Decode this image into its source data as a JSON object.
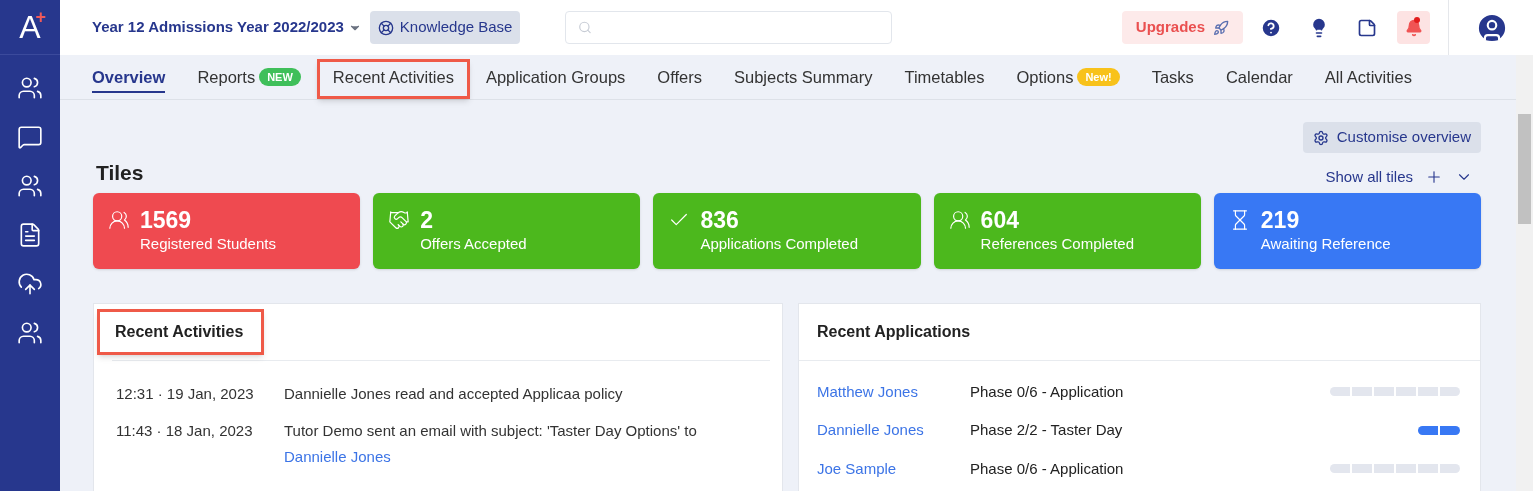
{
  "logo": {
    "letter": "A",
    "mark": "+"
  },
  "header": {
    "year_selector": "Year 12 Admissions Year 2022/2023",
    "knowledge_base": "Knowledge Base",
    "upgrades": "Upgrades",
    "notifications_unread": true
  },
  "tabs": [
    {
      "label": "Overview",
      "selected": true,
      "highlighted": false
    },
    {
      "label": "Reports",
      "selected": false,
      "highlighted": false,
      "badge": {
        "label": "NEW",
        "color": "#3fbf5a"
      }
    },
    {
      "label": "Recent Activities",
      "selected": false,
      "highlighted": true
    },
    {
      "label": "Application Groups",
      "selected": false,
      "highlighted": false
    },
    {
      "label": "Offers",
      "selected": false,
      "highlighted": false
    },
    {
      "label": "Subjects Summary",
      "selected": false,
      "highlighted": false
    },
    {
      "label": "Timetables",
      "selected": false,
      "highlighted": false
    },
    {
      "label": "Options",
      "selected": false,
      "highlighted": false,
      "badge": {
        "label": "New!",
        "color": "#f8c21b"
      }
    },
    {
      "label": "Tasks",
      "selected": false,
      "highlighted": false
    },
    {
      "label": "Calendar",
      "selected": false,
      "highlighted": false
    },
    {
      "label": "All Activities",
      "selected": false,
      "highlighted": false
    }
  ],
  "customise_button": "Customise overview",
  "tiles_title": "Tiles",
  "show_all_tiles": "Show all tiles",
  "tiles": [
    {
      "kind": "users",
      "value": "1569",
      "label": "Registered Students",
      "color": "#ef4a50"
    },
    {
      "kind": "handshake",
      "value": "2",
      "label": "Offers Accepted",
      "color": "#4cb81d"
    },
    {
      "kind": "check",
      "value": "836",
      "label": "Applications Completed",
      "color": "#4cb81d"
    },
    {
      "kind": "users",
      "value": "604",
      "label": "References Completed",
      "color": "#4cb81d"
    },
    {
      "kind": "hourglass",
      "value": "219",
      "label": "Awaiting Reference",
      "color": "#3878f4"
    }
  ],
  "recent_activities": {
    "title": "Recent Activities",
    "highlighted": true,
    "items": [
      {
        "time": "12:31 · 19 Jan, 2023",
        "text": "Dannielle Jones read and accepted Applicaa policy"
      },
      {
        "time": "11:43 · 18 Jan, 2023",
        "text": "Tutor Demo sent an email with subject: 'Taster Day Options' to",
        "link": "Dannielle Jones"
      }
    ]
  },
  "recent_applications": {
    "title": "Recent Applications",
    "rows": [
      {
        "name": "Matthew Jones",
        "phase": "Phase 0/6 - Application",
        "segments": [
          {
            "filled": false
          },
          {
            "filled": false
          },
          {
            "filled": false
          },
          {
            "filled": false
          },
          {
            "filled": false
          },
          {
            "filled": false
          }
        ]
      },
      {
        "name": "Dannielle Jones",
        "phase": "Phase 2/2 - Taster Day",
        "segments": [
          {
            "filled": true
          },
          {
            "filled": true
          }
        ]
      },
      {
        "name": "Joe Sample",
        "phase": "Phase 0/6 - Application",
        "segments": [
          {
            "filled": false
          },
          {
            "filled": false
          },
          {
            "filled": false
          },
          {
            "filled": false
          },
          {
            "filled": false
          },
          {
            "filled": false
          }
        ]
      }
    ]
  }
}
